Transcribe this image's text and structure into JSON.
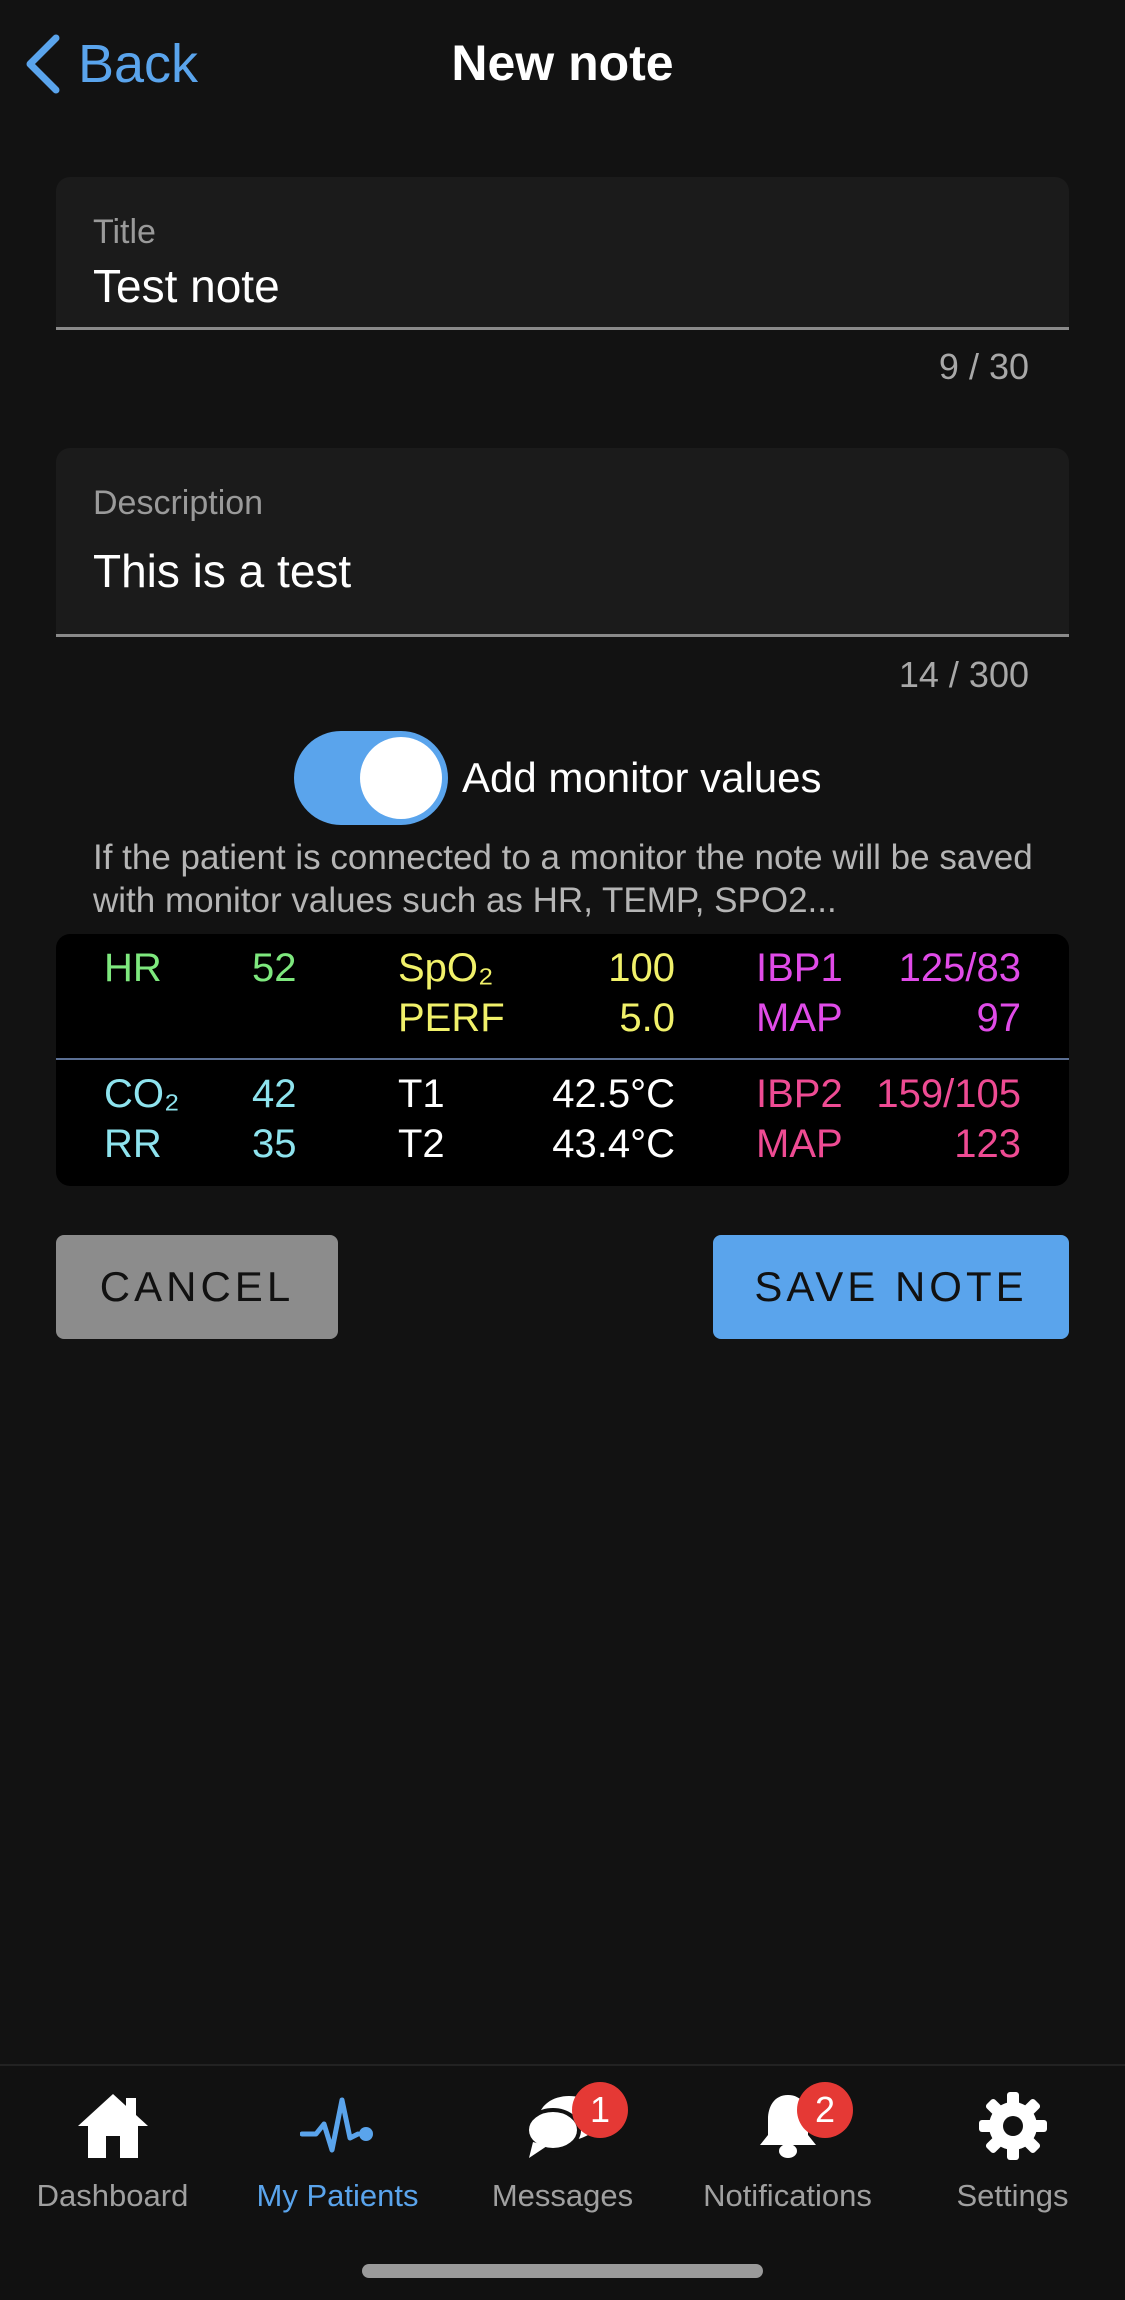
{
  "header": {
    "back_label": "Back",
    "title": "New note"
  },
  "title_field": {
    "label": "Title",
    "value": "Test note",
    "counter": "9 / 30"
  },
  "description_field": {
    "label": "Description",
    "value": "This is a test",
    "counter": "14 / 300"
  },
  "monitor_toggle": {
    "label": "Add monitor values",
    "on": true,
    "helper": "If the patient is connected to a monitor the note will be saved with monitor values such as HR, TEMP, SPO2..."
  },
  "monitor": {
    "hr_label": "HR",
    "hr_value": "52",
    "spo2_label": "SpO₂",
    "spo2_value": "100",
    "perf_label": "PERF",
    "perf_value": "5.0",
    "ibp1_label": "IBP1",
    "ibp1_value": "125/83",
    "map1_label": "MAP",
    "map1_value": "97",
    "co2_label": "CO₂",
    "co2_value": "42",
    "rr_label": "RR",
    "rr_value": "35",
    "t1_label": "T1",
    "t1_value": "42.5°C",
    "t2_label": "T2",
    "t2_value": "43.4°C",
    "ibp2_label": "IBP2",
    "ibp2_value": "159/105",
    "map2_label": "MAP",
    "map2_value": "123"
  },
  "colors": {
    "accent": "#5aa4ec",
    "hr": "#7ee87e",
    "spo2": "#f1f16a",
    "ibp1": "#e04be8",
    "co2": "#8ee3ee",
    "temp": "#ffffff",
    "ibp2": "#ee4b93",
    "badge": "#e53935"
  },
  "buttons": {
    "cancel": "CANCEL",
    "save": "SAVE NOTE"
  },
  "nav": {
    "items": [
      {
        "label": "Dashboard",
        "icon": "home-icon"
      },
      {
        "label": "My Patients",
        "icon": "heartbeat-icon",
        "active": true
      },
      {
        "label": "Messages",
        "icon": "chat-icon",
        "badge": "1"
      },
      {
        "label": "Notifications",
        "icon": "bell-icon",
        "badge": "2"
      },
      {
        "label": "Settings",
        "icon": "gear-icon"
      }
    ]
  }
}
